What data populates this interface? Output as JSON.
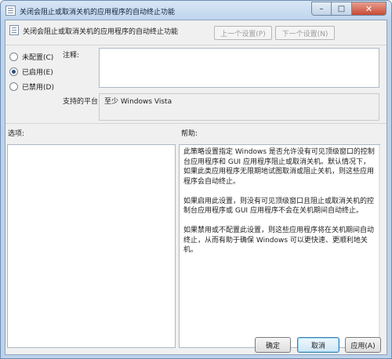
{
  "window": {
    "title": "关闭会阻止或取消关机的应用程序的自动终止功能",
    "controls": {
      "minimize": "–",
      "maximize": "□",
      "close": "✕"
    }
  },
  "header": {
    "title": "关闭会阻止或取消关机的应用程序的自动终止功能",
    "prev_label": "上一个设置(P)",
    "next_label": "下一个设置(N)"
  },
  "options": [
    {
      "label": "未配置(C)",
      "checked": false
    },
    {
      "label": "已启用(E)",
      "checked": true
    },
    {
      "label": "已禁用(D)",
      "checked": false
    }
  ],
  "comment": {
    "label": "注释:",
    "value": ""
  },
  "platform": {
    "label": "支持的平台:",
    "value": "至少 Windows Vista"
  },
  "sections": {
    "options_label": "选项:",
    "help_label": "帮助:"
  },
  "help": {
    "paragraphs": [
      "此策略设置指定 Windows 是否允许没有可见顶级窗口的控制台应用程序和 GUI 应用程序阻止或取消关机。默认情况下，如果此类应用程序无限期地试图取消或阻止关机，则这些应用程序会自动终止。",
      "如果启用此设置，则没有可见顶级窗口且阻止或取消关机的控制台应用程序或 GUI 应用程序不会在关机期间自动终止。",
      "如果禁用或不配置此设置，则这些应用程序将在关机期间自动终止，从而有助于确保 Windows 可以更快速、更顺利地关机。"
    ]
  },
  "buttons": {
    "ok": "确定",
    "cancel": "取消",
    "apply": "应用(A)"
  }
}
